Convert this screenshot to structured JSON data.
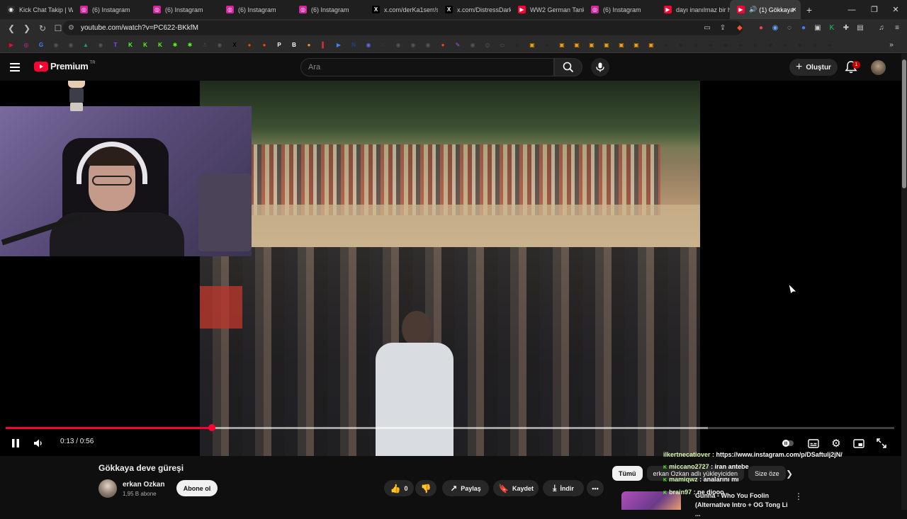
{
  "browser": {
    "tabs": [
      {
        "title": "Kick Chat Takip | W",
        "icon": "kick-icon",
        "color": "#2b2b2b"
      },
      {
        "title": "(6) Instagram",
        "icon": "instagram-icon",
        "color": "#d6249f"
      },
      {
        "title": "(6) Instagram",
        "icon": "instagram-icon",
        "color": "#d6249f"
      },
      {
        "title": "(6) Instagram",
        "icon": "instagram-icon",
        "color": "#d6249f"
      },
      {
        "title": "(6) Instagram",
        "icon": "instagram-icon",
        "color": "#d6249f"
      },
      {
        "title": "x.com/derKa1serr/st",
        "icon": "x-icon",
        "color": "#000000"
      },
      {
        "title": "x.com/DistressDark",
        "icon": "x-icon",
        "color": "#000000"
      },
      {
        "title": "WW2 German Tanks",
        "icon": "youtube-icon",
        "color": "#ff0033"
      },
      {
        "title": "(6) Instagram",
        "icon": "instagram-icon",
        "color": "#d6249f"
      },
      {
        "title": "dayı inanılmaz bir h",
        "icon": "youtube-icon",
        "color": "#ff0033"
      }
    ],
    "active_tab": {
      "title": "(1) Gökkaya",
      "icon": "youtube-icon",
      "color": "#ff0033"
    },
    "url": "youtube.com/watch?v=PC622-BKkfM",
    "bookmarks": [
      {
        "icon": "youtube-icon",
        "glyph": "▶",
        "color": "#ff0033"
      },
      {
        "icon": "instagram-icon",
        "glyph": "◎",
        "color": "#d6249f"
      },
      {
        "icon": "translate-icon",
        "glyph": "G",
        "color": "#4285f4"
      },
      {
        "icon": "globe-icon",
        "glyph": "◉",
        "color": "#555555"
      },
      {
        "icon": "globe-icon",
        "glyph": "◉",
        "color": "#555555"
      },
      {
        "icon": "drive-icon",
        "glyph": "▲",
        "color": "#1fa463"
      },
      {
        "icon": "globe-icon",
        "glyph": "◉",
        "color": "#555555"
      },
      {
        "icon": "twitch-icon",
        "glyph": "T",
        "color": "#9146ff"
      },
      {
        "icon": "kick-icon",
        "glyph": "K",
        "color": "#53fc18"
      },
      {
        "icon": "kick-icon",
        "glyph": "K",
        "color": "#53fc18"
      },
      {
        "icon": "kick-icon",
        "glyph": "K",
        "color": "#53fc18"
      },
      {
        "icon": "star-icon",
        "glyph": "✱",
        "color": "#53fc18"
      },
      {
        "icon": "star-icon",
        "glyph": "✱",
        "color": "#53fc18"
      },
      {
        "icon": "anchor-icon",
        "glyph": "⚓",
        "color": "#444444"
      },
      {
        "icon": "globe-icon",
        "glyph": "◉",
        "color": "#555555"
      },
      {
        "icon": "x-icon",
        "glyph": "X",
        "color": "#000000"
      },
      {
        "icon": "reddit-icon",
        "glyph": "●",
        "color": "#ff4500"
      },
      {
        "icon": "reddit-icon",
        "glyph": "●",
        "color": "#ff4500"
      },
      {
        "icon": "p-icon",
        "glyph": "P",
        "color": "#ffffff"
      },
      {
        "icon": "b-icon",
        "glyph": "B",
        "color": "#ffffff"
      },
      {
        "icon": "coin-icon",
        "glyph": "●",
        "color": "#f7931a"
      },
      {
        "icon": "pin-icon",
        "glyph": "▌",
        "color": "#c4302b"
      },
      {
        "icon": "play-icon",
        "glyph": "▶",
        "color": "#3b82f6"
      },
      {
        "icon": "nba-icon",
        "glyph": "N",
        "color": "#1d428a"
      },
      {
        "icon": "globe-icon",
        "glyph": "◉",
        "color": "#6366f1"
      },
      {
        "icon": "k-icon",
        "glyph": "K",
        "color": "#333333"
      },
      {
        "icon": "globe-icon",
        "glyph": "◉",
        "color": "#555555"
      },
      {
        "icon": "globe-icon",
        "glyph": "◉",
        "color": "#555555"
      },
      {
        "icon": "globe-icon",
        "glyph": "◉",
        "color": "#555555"
      },
      {
        "icon": "reddit-icon",
        "glyph": "●",
        "color": "#ff4500"
      },
      {
        "icon": "feather-icon",
        "glyph": "✎",
        "color": "#a855f7"
      },
      {
        "icon": "globe-icon",
        "glyph": "◉",
        "color": "#555555"
      },
      {
        "icon": "circle-icon",
        "glyph": "◎",
        "color": "#555555"
      },
      {
        "icon": "folder-icon",
        "glyph": "▭",
        "color": "#555555"
      },
      {
        "icon": "steam-icon",
        "glyph": "◆",
        "color": "#1b2838"
      },
      {
        "icon": "box-icon",
        "glyph": "▣",
        "color": "#f59e0b"
      },
      {
        "icon": "steam-icon",
        "glyph": "◆",
        "color": "#1b2838"
      },
      {
        "icon": "box-icon",
        "glyph": "▣",
        "color": "#f59e0b"
      },
      {
        "icon": "box-icon",
        "glyph": "▣",
        "color": "#f59e0b"
      },
      {
        "icon": "box-icon",
        "glyph": "▣",
        "color": "#f59e0b"
      },
      {
        "icon": "box-icon",
        "glyph": "▣",
        "color": "#f59e0b"
      },
      {
        "icon": "box-icon",
        "glyph": "▣",
        "color": "#f59e0b"
      },
      {
        "icon": "box-icon",
        "glyph": "▣",
        "color": "#f59e0b"
      },
      {
        "icon": "box-icon",
        "glyph": "▣",
        "color": "#f59e0b"
      },
      {
        "icon": "steam-icon",
        "glyph": "◆",
        "color": "#1b2838"
      },
      {
        "icon": "steam-icon",
        "glyph": "◆",
        "color": "#1b2838"
      },
      {
        "icon": "steam-icon",
        "glyph": "◆",
        "color": "#1b2838"
      },
      {
        "icon": "steam-icon",
        "glyph": "◆",
        "color": "#1b2838"
      },
      {
        "icon": "steam-icon",
        "glyph": "◆",
        "color": "#1b2838"
      },
      {
        "icon": "steam-icon",
        "glyph": "◆",
        "color": "#1b2838"
      },
      {
        "icon": "steam-icon",
        "glyph": "◆",
        "color": "#1b2838"
      },
      {
        "icon": "steam-icon",
        "glyph": "◆",
        "color": "#1b2838"
      },
      {
        "icon": "steam-icon",
        "glyph": "◆",
        "color": "#1b2838"
      },
      {
        "icon": "steam-icon",
        "glyph": "◆",
        "color": "#1b2838"
      },
      {
        "icon": "steam-icon",
        "glyph": "◆",
        "color": "#1b2838"
      },
      {
        "icon": "steam-icon",
        "glyph": "◆",
        "color": "#1b2838"
      }
    ],
    "bookmarks_overflow": "»"
  },
  "youtube": {
    "logo_text": "Premium",
    "country_code": "TR",
    "search_placeholder": "Ara",
    "create_label": "Oluştur",
    "notification_count": "1"
  },
  "player": {
    "current_time": "0:13",
    "duration": "0:56",
    "time_text": "0:13 / 0:56",
    "progress_fraction": 0.2321,
    "buffered_fraction": 0.79
  },
  "video": {
    "title": "Gökkaya deve güreşi",
    "channel_name": "erkan Ozkan",
    "subscribers": "1,95 B abone",
    "subscribe_label": "Abone ol",
    "like_count": "0",
    "share_label": "Paylaş",
    "save_label": "Kaydet",
    "download_label": "İndir"
  },
  "chips": [
    {
      "label": "Tümü",
      "active": true
    },
    {
      "label": "erkan Ozkan adlı yükleyiciden",
      "active": false
    },
    {
      "label": "Size öze",
      "active": false
    }
  ],
  "recommendation": {
    "title": "Gunna - Who You Foolin (Alternative Intro + OG Tong Li ..."
  },
  "chat_overlay": [
    {
      "user": "ilkertnecatiover",
      "message": "https://www.instagram.com/p/DSaftulj2jN/"
    },
    {
      "user": "miccano2727",
      "message": "iran antebe"
    },
    {
      "user": "mamiqwz",
      "message": "analarını mı"
    },
    {
      "user": "brain97",
      "message": "ne diooo"
    }
  ]
}
